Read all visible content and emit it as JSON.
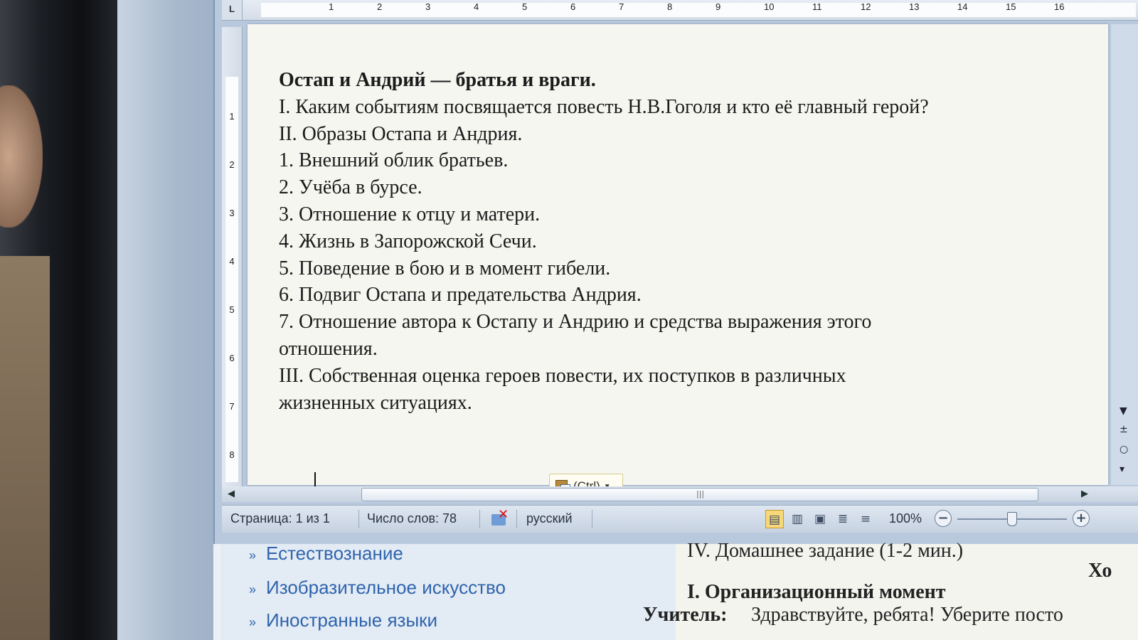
{
  "ruler": {
    "corner": "L",
    "numbers": [
      "1",
      "2",
      "3",
      "4",
      "5",
      "6",
      "7",
      "8",
      "9",
      "10",
      "11",
      "12",
      "13",
      "14",
      "15",
      "16"
    ],
    "vertical_numbers": [
      "1",
      "2",
      "3",
      "4",
      "5",
      "6",
      "7",
      "8"
    ]
  },
  "document": {
    "title": "Остап и Андрий — братья и враги.",
    "lines": [
      "I. Каким событиям посвящается повесть Н.В.Гоголя и кто её главный герой?",
      "II. Образы Остапа и Андрия.",
      "1. Внешний облик братьев.",
      "2. Учёба в бурсе.",
      "3. Отношение к отцу и матери.",
      "4. Жизнь в Запорожской Сечи.",
      "5. Поведение в бою и в момент гибели.",
      "6. Подвиг Остапа и предательства Андрия.",
      "7. Отношение автора к Остапу и Андрию и средства выражения этого",
      "отношения.",
      "III. Собственная оценка героев повести, их поступков в различных",
      "жизненных ситуациях."
    ],
    "paste_options_label": "(Ctrl)"
  },
  "status": {
    "page": "Страница: 1 из 1",
    "words": "Число слов: 78",
    "language": "русский",
    "zoom": "100%",
    "zoom_level": 1.0,
    "view_icons": [
      "print-layout-icon",
      "full-screen-reading-icon",
      "web-layout-icon",
      "outline-icon",
      "draft-icon"
    ]
  },
  "lower_panel": {
    "links": [
      "Естествознание",
      "Изобразительное искусство",
      "Иностранные языки"
    ],
    "doc_line1": "IV. Домашнее задание (1-2 мин.)",
    "doc_right_fragment": "Хо",
    "doc_heading": "I. Организационный момент",
    "doc_teacher_label": "Учитель:",
    "doc_teacher_text": "Здравствуйте, ребята! Уберите посто"
  }
}
